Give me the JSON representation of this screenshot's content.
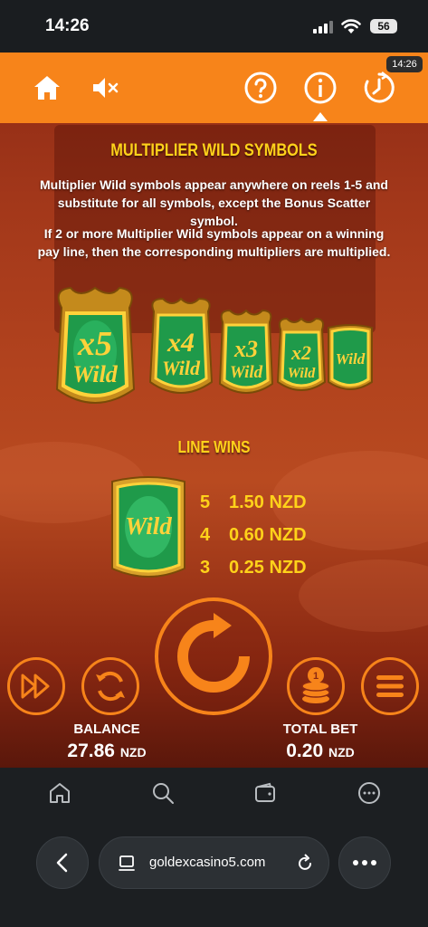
{
  "status_bar": {
    "time": "14:26",
    "battery": "56"
  },
  "top_bar": {
    "time_badge": "14:26"
  },
  "multiplier_section": {
    "title": "MULTIPLIER WILD SYMBOLS",
    "para1": "Multiplier Wild symbols appear anywhere on reels 1-5 and substitute for all symbols, except the Bonus Scatter symbol.",
    "para2": "If 2 or more Multiplier Wild symbols appear on a winning pay line, then the corresponding multipliers are multiplied.",
    "symbols": [
      {
        "mult": "x5",
        "word": "Wild"
      },
      {
        "mult": "x4",
        "word": "Wild"
      },
      {
        "mult": "x3",
        "word": "Wild"
      },
      {
        "mult": "x2",
        "word": "Wild"
      },
      {
        "mult": "",
        "word": "Wild"
      }
    ]
  },
  "line_wins": {
    "title": "LINE WINS",
    "symbol_word": "Wild",
    "rows": [
      {
        "count": "5",
        "value": "1.50 NZD"
      },
      {
        "count": "4",
        "value": "0.60 NZD"
      },
      {
        "count": "3",
        "value": "0.25 NZD"
      }
    ]
  },
  "controls": {
    "balance_label": "BALANCE",
    "balance_value": "27.86",
    "balance_currency": "NZD",
    "bet_label": "TOTAL BET",
    "bet_value": "0.20",
    "bet_currency": "NZD"
  },
  "browser": {
    "url": "goldexcasino5.com"
  },
  "colors": {
    "accent": "#f7841a",
    "gold": "#ffd21a",
    "wild_green": "#1f9a4a"
  },
  "icons": [
    "home-icon",
    "mute-icon",
    "help-icon",
    "info-icon",
    "history-icon",
    "spin-icon",
    "turbo-icon",
    "autoplay-icon",
    "bet-coins-icon",
    "menu-icon"
  ]
}
